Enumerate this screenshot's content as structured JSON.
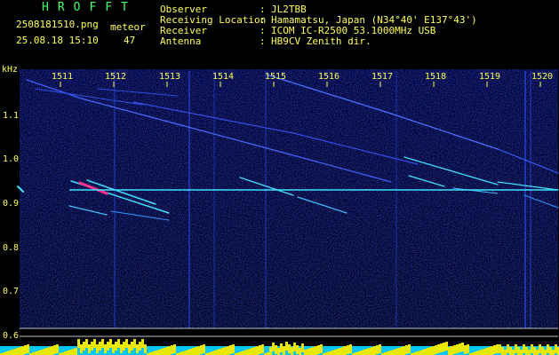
{
  "app_title": "HROFFT",
  "file_name": "2508181510.png",
  "date_time": "25.08.18 15:10",
  "meteor": {
    "label": "meteor",
    "count": "47"
  },
  "station": {
    "rows": [
      {
        "label": "Observer",
        "value": "JL2TBB"
      },
      {
        "label": "Receiving Location",
        "value": "Hamamatsu, Japan (N34°40' E137°43')"
      },
      {
        "label": "Receiver",
        "value": "ICOM IC-R2500 53.1000MHz USB"
      },
      {
        "label": "Antenna",
        "value": "HB9CV Zenith dir."
      }
    ],
    "colon": ":"
  },
  "axis": {
    "y_unit": "kHz",
    "y_ticks": [
      "1.1",
      "1.0",
      "0.9",
      "0.8",
      "0.7",
      "0.6"
    ],
    "time_ticks": [
      "1511",
      "1512",
      "1513",
      "1514",
      "1515",
      "1516",
      "1517",
      "1518",
      "1519",
      "1520"
    ]
  },
  "colors": {
    "signal": "#40e0ff",
    "background": "#000022",
    "noise": "#1030c0",
    "meteor_hot": "#ff3090",
    "yellow_bar": "#ffff00",
    "cyan_bar": "#00c8ff"
  }
}
